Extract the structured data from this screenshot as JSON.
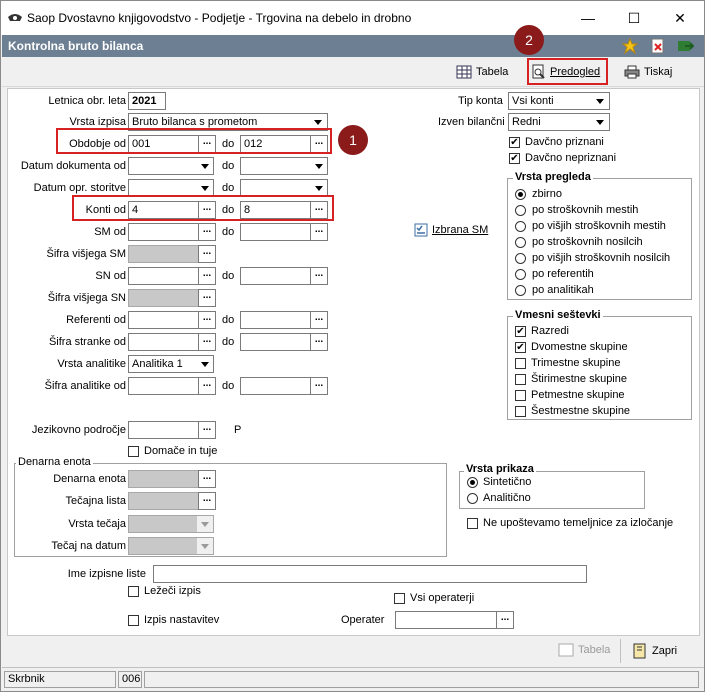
{
  "window": {
    "title": "Saop Dvostavno knjigovodstvo - Podjetje - Trgovina na debelo in drobno",
    "minimize": "—",
    "maximize": "☐",
    "close": "✕"
  },
  "header": {
    "title": "Kontrolna bruto bilanca"
  },
  "toolbar": {
    "tabela": "Tabela",
    "predogled": "Predogled",
    "tiskaj": "Tiskaj"
  },
  "badges": {
    "one": "1",
    "two": "2"
  },
  "form": {
    "letnica_label": "Letnica obr. leta",
    "letnica_value": "2021",
    "vrsta_izpisa_label": "Vrsta izpisa",
    "vrsta_izpisa_value": "Bruto bilanca s prometom",
    "obdobje_label": "Obdobje od",
    "obdobje_od": "001",
    "obdobje_do": "012",
    "datum_dok_label": "Datum dokumenta od",
    "datum_opr_label": "Datum opr. storitve",
    "konti_label": "Konti od",
    "konti_od": "4",
    "konti_do": "8",
    "sm_label": "SM od",
    "sifra_visjega_sm_label": "Šifra višjega SM",
    "sn_label": "SN od",
    "sifra_visjega_sn_label": "Šifra višjega SN",
    "referenti_label": "Referenti od",
    "sifra_stranke_label": "Šifra stranke od",
    "vrsta_analitike_label": "Vrsta analitike",
    "vrsta_analitike_value": "Analitika 1",
    "sifra_analitike_label": "Šifra analitike od",
    "jezikovno_label": "Jezikovno področje",
    "jezikovno_suffix": "P",
    "domace_label": "Domače in tuje",
    "do": "do",
    "ellipsis": "..."
  },
  "denarna": {
    "group": "Denarna enota",
    "enota": "Denarna enota",
    "tecajna": "Tečajna lista",
    "vrsta": "Vrsta tečaja",
    "datum": "Tečaj na datum"
  },
  "right": {
    "tip_konta_label": "Tip konta",
    "tip_konta_value": "Vsi konti",
    "izven_label": "Izven bilančni",
    "izven_value": "Redni",
    "davcno_priznani": "Davčno priznani",
    "davcno_nepriznani": "Davčno nepriznani",
    "izbrana_sm": "Izbrana SM"
  },
  "vrsta_pregleda": {
    "title": "Vrsta pregleda",
    "options": [
      "zbirno",
      "po stroškovnih mestih",
      "po višjih stroškovnih mestih",
      "po stroškovnih nosilcih",
      "po višjih stroškovnih nosilcih",
      "po referentih",
      "po analitikah"
    ]
  },
  "vmesni": {
    "title": "Vmesni seštevki",
    "options": [
      "Razredi",
      "Dvomestne skupine",
      "Trimestne skupine",
      "Štirimestne skupine",
      "Petmestne skupine",
      "Šestmestne skupine"
    ]
  },
  "vrsta_prikaza": {
    "title": "Vrsta prikaza",
    "options": [
      "Sintetično",
      "Analitično"
    ]
  },
  "ne_upostevamo": "Ne upoštevamo temeljnice za izločanje",
  "ime_izpisne": "Ime izpisne liste",
  "lezeci": "Ležeči izpis",
  "vsi_operaterji": "Vsi operaterji",
  "izpis_nastavitev": "Izpis nastavitev",
  "operater": "Operater",
  "bottom": {
    "tabela": "Tabela",
    "zapri": "Zapri"
  },
  "status": {
    "user": "Skrbnik",
    "code": "006"
  }
}
